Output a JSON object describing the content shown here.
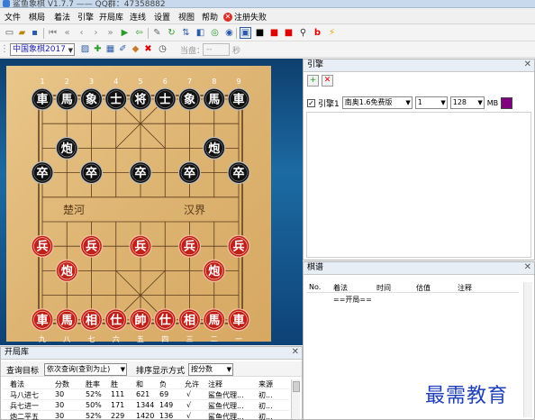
{
  "window": {
    "title": "鲨鱼象棋 V1.7.7 —— QQ群：47358882"
  },
  "menu": [
    "文件",
    "棋局",
    "着法",
    "引擎",
    "开局库",
    "连线",
    "设置",
    "视图",
    "帮助"
  ],
  "menu_register": "注册失败",
  "toolbar2": {
    "game_select": "中国象棋2017",
    "current_label": "当盘：",
    "current_value": "--",
    "seconds_label": "秒"
  },
  "board": {
    "top_numbers": [
      "1",
      "2",
      "3",
      "4",
      "5",
      "6",
      "7",
      "8",
      "9"
    ],
    "bottom_numbers": [
      "九",
      "八",
      "七",
      "六",
      "五",
      "四",
      "三",
      "二",
      "一"
    ],
    "river_left": "楚河",
    "river_right": "汉界",
    "black_pieces": [
      "車",
      "馬",
      "象",
      "士",
      "将",
      "士",
      "象",
      "馬",
      "車",
      "炮",
      "炮",
      "卒",
      "卒",
      "卒",
      "卒",
      "卒"
    ],
    "red_pieces": [
      "兵",
      "兵",
      "兵",
      "兵",
      "兵",
      "炮",
      "炮",
      "車",
      "馬",
      "相",
      "仕",
      "帥",
      "仕",
      "相",
      "馬",
      "車"
    ]
  },
  "engine_panel": {
    "title": "引擎",
    "engine_checked": true,
    "engine_label": "引擎1",
    "engine_name": "南奥1.6免费版",
    "threads": "1",
    "hash": "128",
    "hash_unit": "MB",
    "color": "#800080"
  },
  "record_panel": {
    "title": "棋谱",
    "columns": [
      "No.",
      "着法",
      "时间",
      "估值",
      "注释"
    ],
    "rows": [
      {
        "no": "",
        "move": "==开局==",
        "time": "",
        "score": "",
        "note": ""
      }
    ]
  },
  "opening_panel": {
    "title": "开局库",
    "query_label": "查询目标",
    "query_value": "依次查询(查到为止)",
    "sort_label": "排序显示方式",
    "sort_value": "按分数",
    "columns": [
      "着法",
      "分数",
      "胜率",
      "胜",
      "和",
      "负",
      "允许",
      "注释",
      "来源"
    ],
    "rows": [
      {
        "move": "马八进七",
        "score": "30",
        "winrate": "52%",
        "win": "111",
        "draw": "621",
        "loss": "69",
        "allow": "√",
        "note": "鲨鱼代理...",
        "source": "初..."
      },
      {
        "move": "兵七进一",
        "score": "30",
        "winrate": "50%",
        "win": "171",
        "draw": "1344",
        "loss": "149",
        "allow": "√",
        "note": "鲨鱼代理...",
        "source": "初..."
      },
      {
        "move": "炮二平五",
        "score": "30",
        "winrate": "52%",
        "win": "229",
        "draw": "1420",
        "loss": "136",
        "allow": "√",
        "note": "鲨鱼代理...",
        "source": "初..."
      }
    ]
  },
  "watermark": "最需教育"
}
